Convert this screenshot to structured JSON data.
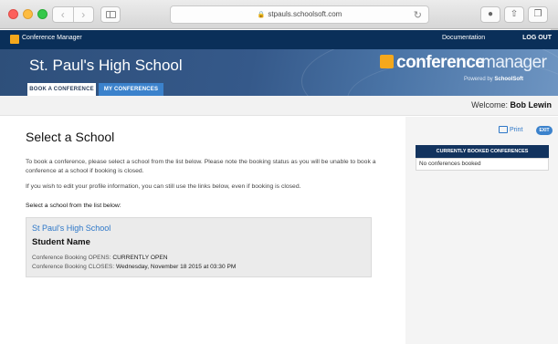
{
  "browser": {
    "url": "stpauls.schoolsoft.com",
    "nav_back": "‹",
    "nav_forward": "›",
    "reload_icon": "↻",
    "lock_icon": "🔒"
  },
  "topbar": {
    "app_name": "Conference Manager",
    "documentation": "Documentation",
    "logout": "LOG OUT"
  },
  "banner": {
    "school_title": "St. Paul's High School",
    "brand_bold": "conference",
    "brand_light": "manager",
    "powered_prefix": "Powered by",
    "powered_brand": "SchoolSoft",
    "tabs": [
      {
        "label": "BOOK A CONFERENCE",
        "active": true
      },
      {
        "label": "MY CONFERENCES",
        "active": false
      }
    ]
  },
  "welcome": {
    "prefix": "Welcome:",
    "name": "Bob Lewin"
  },
  "main": {
    "heading": "Select a School",
    "intro": "To book a conference, please select a school from the list below. Please note the booking status as you will be unable to book a conference at a school if booking is closed.",
    "profile_note": "If you wish to edit your profile information, you can still use the links below, even if booking is closed.",
    "list_label": "Select a school from the list below:",
    "school_card": {
      "name": "St Paul's High School",
      "student": "Student Name",
      "opens_label": "Conference Booking OPENS:",
      "opens_value": "CURRENTLY OPEN",
      "closes_label": "Conference Booking CLOSES:",
      "closes_value": "Wednesday, November 18 2015 at 03:30 PM"
    }
  },
  "sidebar": {
    "print_label": "Print",
    "exit_label": "EXIT",
    "booked_header": "CURRENTLY BOOKED CONFERENCES",
    "booked_empty": "No conferences booked"
  },
  "colors": {
    "topbar": "#0a2f59",
    "accent": "#f4a81c",
    "link": "#2d77c8",
    "tab_inactive": "#3b82cc"
  }
}
